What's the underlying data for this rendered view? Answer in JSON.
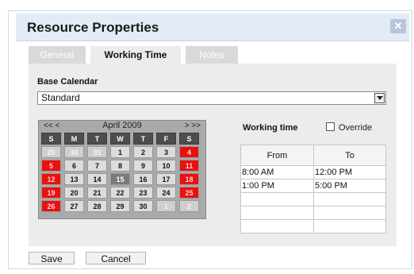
{
  "dialog": {
    "title": "Resource Properties",
    "close_glyph": "✕",
    "close_icon": "close-icon"
  },
  "tabs": [
    {
      "label": "General",
      "active": false
    },
    {
      "label": "Working Time",
      "active": true
    },
    {
      "label": "Notes",
      "active": false
    }
  ],
  "base_calendar": {
    "label": "Base Calendar",
    "selected": "Standard",
    "arrow_icon": "dropdown-arrow-icon"
  },
  "calendar": {
    "prev": "<< <",
    "next": "> >>",
    "month_label": "April 2009",
    "weekday_labels": [
      "S",
      "M",
      "T",
      "W",
      "T",
      "F",
      "S"
    ],
    "weeks": [
      [
        "29",
        "30",
        "31",
        "1",
        "2",
        "3",
        "4"
      ],
      [
        "5",
        "6",
        "7",
        "8",
        "9",
        "10",
        "11"
      ],
      [
        "12",
        "13",
        "14",
        "15",
        "16",
        "17",
        "18"
      ],
      [
        "19",
        "20",
        "21",
        "22",
        "23",
        "24",
        "25"
      ],
      [
        "26",
        "27",
        "28",
        "29",
        "30",
        "1",
        "2"
      ]
    ],
    "selected_day": "15",
    "colors": {
      "weekend": "#e8110f",
      "header": "#4d4d4d",
      "day": "#dcdcdc",
      "selected": "#7a7a7a"
    }
  },
  "working_time": {
    "label": "Working time",
    "override_label": "Override",
    "override_checked": false,
    "headers": [
      "From",
      "To"
    ],
    "rows": [
      [
        "8:00 AM",
        "12:00 PM"
      ],
      [
        "1:00 PM",
        "5:00 PM"
      ],
      [
        "",
        ""
      ],
      [
        "",
        ""
      ],
      [
        "",
        ""
      ]
    ]
  },
  "footer": {
    "save_label": "Save",
    "cancel_label": "Cancel"
  }
}
